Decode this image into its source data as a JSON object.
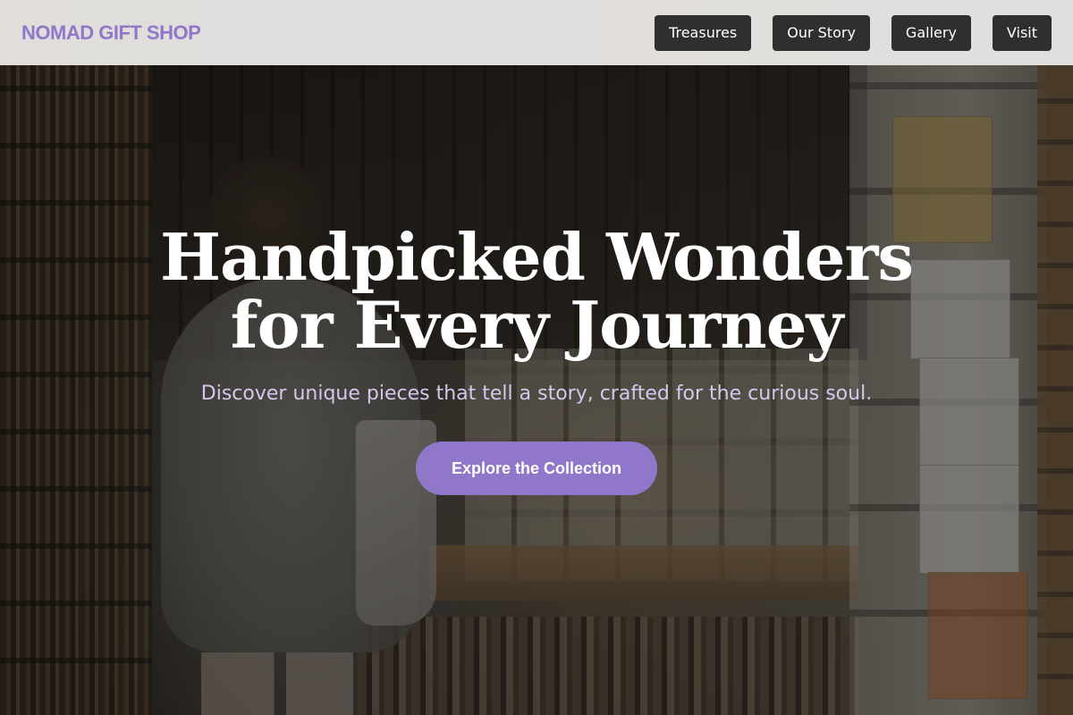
{
  "header": {
    "logo": "NOMAD GIFT SHOP",
    "nav": [
      {
        "label": "Treasures"
      },
      {
        "label": "Our Story"
      },
      {
        "label": "Gallery"
      },
      {
        "label": "Visit"
      }
    ]
  },
  "hero": {
    "title": "Handpicked Wonders for Every Journey",
    "subtitle": "Discover unique pieces that tell a story, crafted for the curious soul.",
    "cta_label": "Explore the Collection"
  },
  "colors": {
    "accent": "#9177c9",
    "nav_button": "#2f2f2f",
    "header_bg": "#e8e6e4",
    "subtitle": "#d3c8ec"
  }
}
